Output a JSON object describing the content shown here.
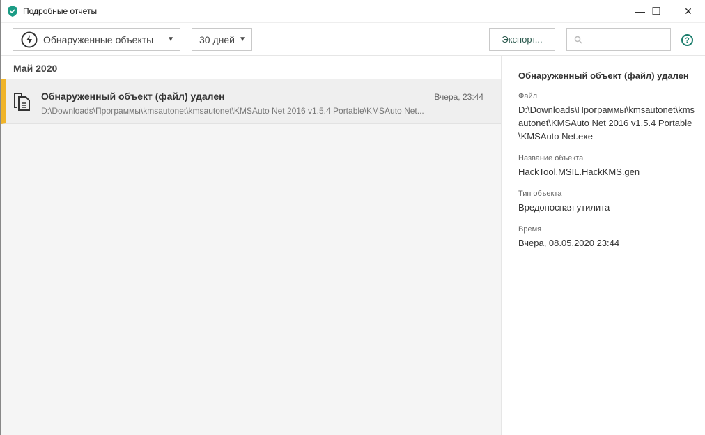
{
  "window": {
    "title": "Подробные отчеты",
    "minimize": "—",
    "maximize": "☐",
    "close": "✕"
  },
  "toolbar": {
    "category": "Обнаруженные объекты",
    "period": "30 дней",
    "export_label": "Экспорт...",
    "search_placeholder": "",
    "help": "?"
  },
  "list": {
    "group": "Май 2020",
    "items": [
      {
        "title": "Обнаруженный объект (файл) удален",
        "path": "D:\\Downloads\\Программы\\kmsautonet\\kmsautonet\\KMSAuto Net 2016 v1.5.4 Portable\\KMSAuto Net...",
        "time": "Вчера, 23:44"
      }
    ]
  },
  "details": {
    "title": "Обнаруженный объект (файл) удален",
    "fields": [
      {
        "label": "Файл",
        "value": "D:\\Downloads\\Программы\\kmsautonet\\kmsautonet\\KMSAuto Net 2016 v1.5.4 Portable\\KMSAuto Net.exe"
      },
      {
        "label": "Название объекта",
        "value": "HackTool.MSIL.HackKMS.gen"
      },
      {
        "label": "Тип объекта",
        "value": "Вредоносная утилита"
      },
      {
        "label": "Время",
        "value": "Вчера, 08.05.2020 23:44"
      }
    ]
  },
  "colors": {
    "accent": "#00a88e",
    "warning": "#f0b429"
  }
}
